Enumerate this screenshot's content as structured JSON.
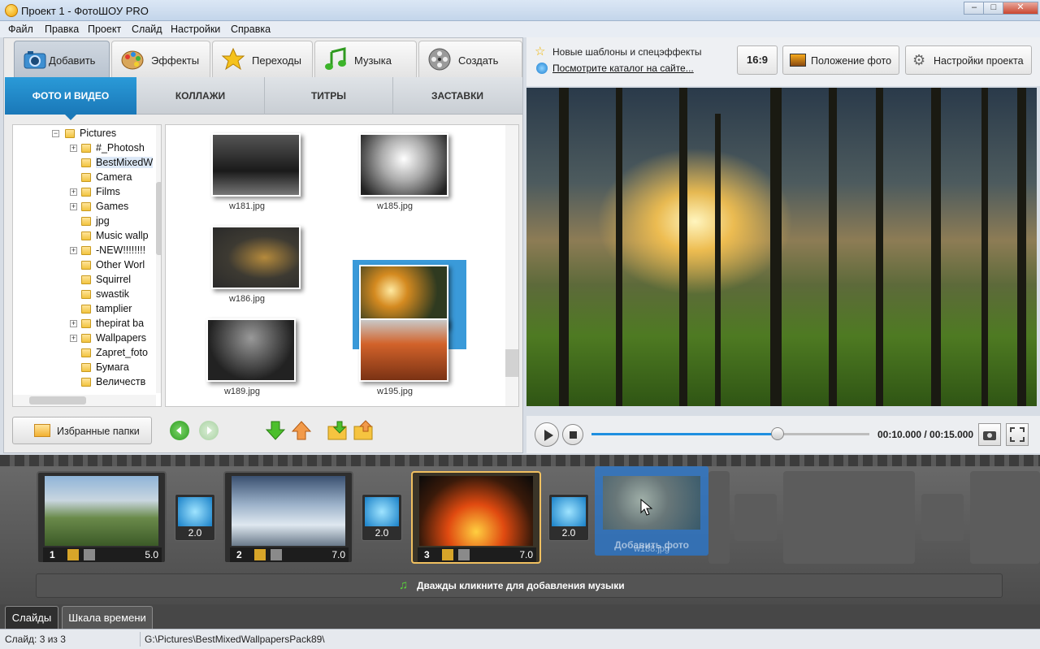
{
  "window": {
    "title": "Проект 1 - ФотоШОУ PRO",
    "buttons": [
      "–",
      "□",
      "✕"
    ]
  },
  "menu": [
    "Файл",
    "Правка",
    "Проект",
    "Слайд",
    "Настройки",
    "Справка"
  ],
  "main_tabs": [
    {
      "label": "Добавить",
      "icon": "camera-icon"
    },
    {
      "label": "Эффекты",
      "icon": "palette-icon"
    },
    {
      "label": "Переходы",
      "icon": "star-icon"
    },
    {
      "label": "Музыка",
      "icon": "music-note-icon"
    },
    {
      "label": "Создать",
      "icon": "film-reel-icon"
    }
  ],
  "sub_tabs": [
    "ФОТО И ВИДЕО",
    "КОЛЛАЖИ",
    "ТИТРЫ",
    "ЗАСТАВКИ"
  ],
  "folder_tree": [
    {
      "label": "Pictures",
      "expander": "−"
    },
    {
      "label": "#_Photosh",
      "expander": "+"
    },
    {
      "label": "BestMixedW",
      "expander": ""
    },
    {
      "label": "Camera",
      "expander": ""
    },
    {
      "label": "Films",
      "expander": "+"
    },
    {
      "label": "Games",
      "expander": "+"
    },
    {
      "label": "jpg",
      "expander": ""
    },
    {
      "label": "Music wallp",
      "expander": ""
    },
    {
      "label": "-NEW!!!!!!!!",
      "expander": "+"
    },
    {
      "label": "Other Worl",
      "expander": ""
    },
    {
      "label": "Squirrel",
      "expander": ""
    },
    {
      "label": "swastik",
      "expander": ""
    },
    {
      "label": "tamplier",
      "expander": ""
    },
    {
      "label": "thepirat ba",
      "expander": "+"
    },
    {
      "label": "Wallpapers",
      "expander": "+"
    },
    {
      "label": "Zapret_foto",
      "expander": ""
    },
    {
      "label": "Бумага",
      "expander": ""
    },
    {
      "label": "Величеств",
      "expander": ""
    }
  ],
  "thumbnails": [
    "w181.jpg",
    "w185.jpg",
    "w186.jpg",
    "w188.jpg",
    "w189.jpg",
    "w195.jpg"
  ],
  "favorites_button": "Избранные папки",
  "news": {
    "line1": "Новые шаблоны и спецэффекты",
    "link": "Посмотрите каталог на сайте..."
  },
  "header_buttons": {
    "ratio": "16:9",
    "photo_position": "Положение фото",
    "project_settings": "Настройки проекта"
  },
  "player": {
    "time": "00:10.000 / 00:15.000",
    "progress": 0.67
  },
  "slides": [
    {
      "num": "1",
      "duration": "5.0"
    },
    {
      "num": "2",
      "duration": "7.0"
    },
    {
      "num": "3",
      "duration": "7.0"
    }
  ],
  "transitions": [
    "2.0",
    "2.0",
    "2.0"
  ],
  "drop_target": {
    "text": "Добавить фото",
    "file": "w188.jpg"
  },
  "music_hint": "Дважды кликните для добавления музыки",
  "bottom_tabs": [
    "Слайды",
    "Шкала времени"
  ],
  "status": {
    "slide": "Слайд: 3 из 3",
    "path": "G:\\Pictures\\BestMixedWallpapersPack89\\"
  }
}
